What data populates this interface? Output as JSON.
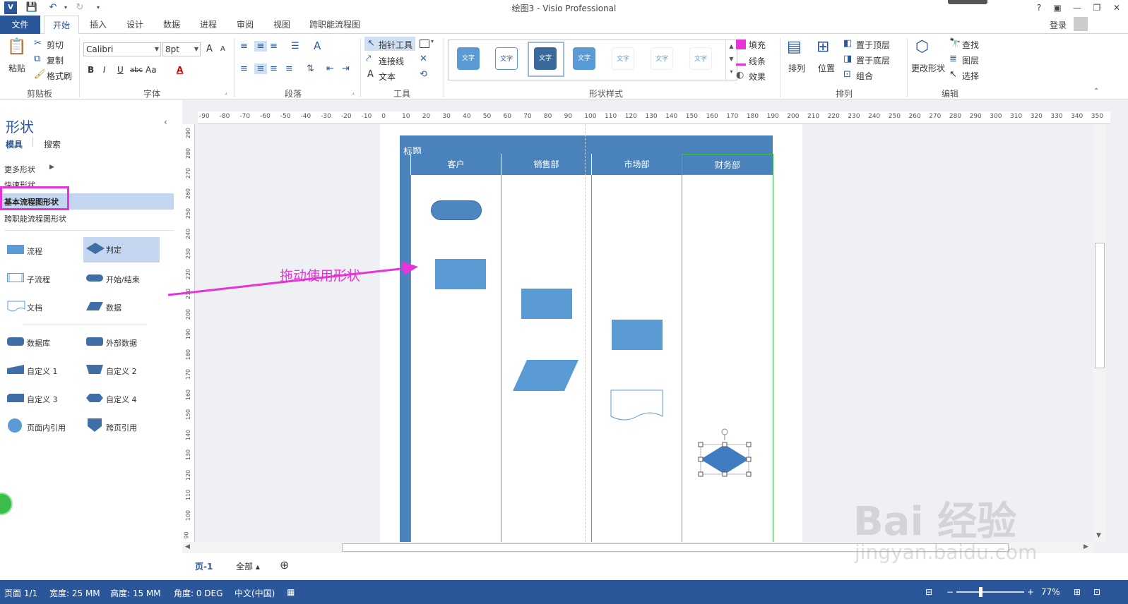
{
  "window": {
    "title": "绘图3 - Visio Professional",
    "help": "?",
    "minimize": "—",
    "restore": "❐",
    "close": "✕",
    "login": "登录"
  },
  "tabs": [
    "文件",
    "开始",
    "插入",
    "设计",
    "数据",
    "进程",
    "审阅",
    "视图",
    "跨职能流程图"
  ],
  "ribbon": {
    "clipboard": {
      "paste": "粘贴",
      "cut": "剪切",
      "copy": "复制",
      "format_painter": "格式刷",
      "label": "剪贴板"
    },
    "font": {
      "name": "Calibri",
      "size": "8pt",
      "bold": "B",
      "italic": "I",
      "underline": "U",
      "strike": "abc",
      "case": "Aa",
      "color": "A",
      "grow": "A",
      "shrink": "A",
      "label": "字体"
    },
    "paragraph": {
      "label": "段落"
    },
    "tools": {
      "pointer": "指针工具",
      "connector": "连接线",
      "text": "文本",
      "label": "工具"
    },
    "shape_styles": {
      "sample": "文字",
      "label": "形状样式",
      "fill": "填充",
      "line": "线条",
      "effects": "效果"
    },
    "arrange": {
      "align": "排列",
      "position": "位置",
      "bring_front": "置于顶层",
      "send_back": "置于底层",
      "group": "组合",
      "label": "排列"
    },
    "editing": {
      "change_shape": "更改形状",
      "find": "查找",
      "layers": "图层",
      "select": "选择",
      "label": "编辑"
    }
  },
  "shapes_panel": {
    "title": "形状",
    "tab_stencils": "模具",
    "tab_search": "搜索",
    "more_shapes": "更多形状",
    "quick_shapes": "快速形状",
    "basic_flowchart": "基本流程图形状",
    "crossfunctional": "跨职能流程图形状",
    "items": [
      {
        "label": "流程",
        "icon": "rect-icon"
      },
      {
        "label": "判定",
        "icon": "diamond-icon"
      },
      {
        "label": "子流程",
        "icon": "subprocess-icon"
      },
      {
        "label": "开始/结束",
        "icon": "terminator-icon"
      },
      {
        "label": "文档",
        "icon": "document-icon"
      },
      {
        "label": "数据",
        "icon": "parallelogram-icon"
      },
      {
        "label": "数据库",
        "icon": "database-icon"
      },
      {
        "label": "外部数据",
        "icon": "external-data-icon"
      },
      {
        "label": "自定义 1",
        "icon": "custom1-icon"
      },
      {
        "label": "自定义 2",
        "icon": "custom2-icon"
      },
      {
        "label": "自定义 3",
        "icon": "custom3-icon"
      },
      {
        "label": "自定义 4",
        "icon": "custom4-icon"
      },
      {
        "label": "页面内引用",
        "icon": "on-page-ref-icon"
      },
      {
        "label": "跨页引用",
        "icon": "off-page-ref-icon"
      }
    ]
  },
  "annotation": "拖动使用形状",
  "canvas": {
    "title": "标题",
    "lanes": [
      "客户",
      "销售部",
      "市场部",
      "财务部"
    ],
    "hruler": [
      "-90",
      "-80",
      "-70",
      "-60",
      "-50",
      "-40",
      "-30",
      "-20",
      "-10",
      "0",
      "10",
      "20",
      "30",
      "40",
      "50",
      "60",
      "70",
      "80",
      "90",
      "100",
      "110",
      "120",
      "130",
      "140",
      "150",
      "160",
      "170",
      "180",
      "190",
      "200",
      "210",
      "220",
      "230",
      "240",
      "250",
      "260",
      "270",
      "280",
      "290",
      "300",
      "310",
      "320",
      "330",
      "340",
      "350"
    ],
    "vruler": [
      "290",
      "280",
      "270",
      "260",
      "250",
      "240",
      "230",
      "220",
      "210",
      "200",
      "190",
      "180",
      "170",
      "160",
      "150",
      "140",
      "130",
      "120",
      "110",
      "100",
      "90"
    ]
  },
  "pagetabs": {
    "page": "页-1",
    "all": "全部 ▴",
    "add": "⊕"
  },
  "status": {
    "page": "页面 1/1",
    "width": "宽度: 25 MM",
    "height": "高度: 15 MM",
    "angle": "角度: 0 DEG",
    "lang": "中文(中国)",
    "zoom": "77%"
  },
  "watermark": {
    "brand": "Bai 经验",
    "url": "jingyan.baidu.com"
  },
  "colors": {
    "accent": "#2b579a",
    "lane_header": "#4a82bb",
    "shape_fill": "#5b9bd5",
    "annotation": "#e535d8"
  }
}
